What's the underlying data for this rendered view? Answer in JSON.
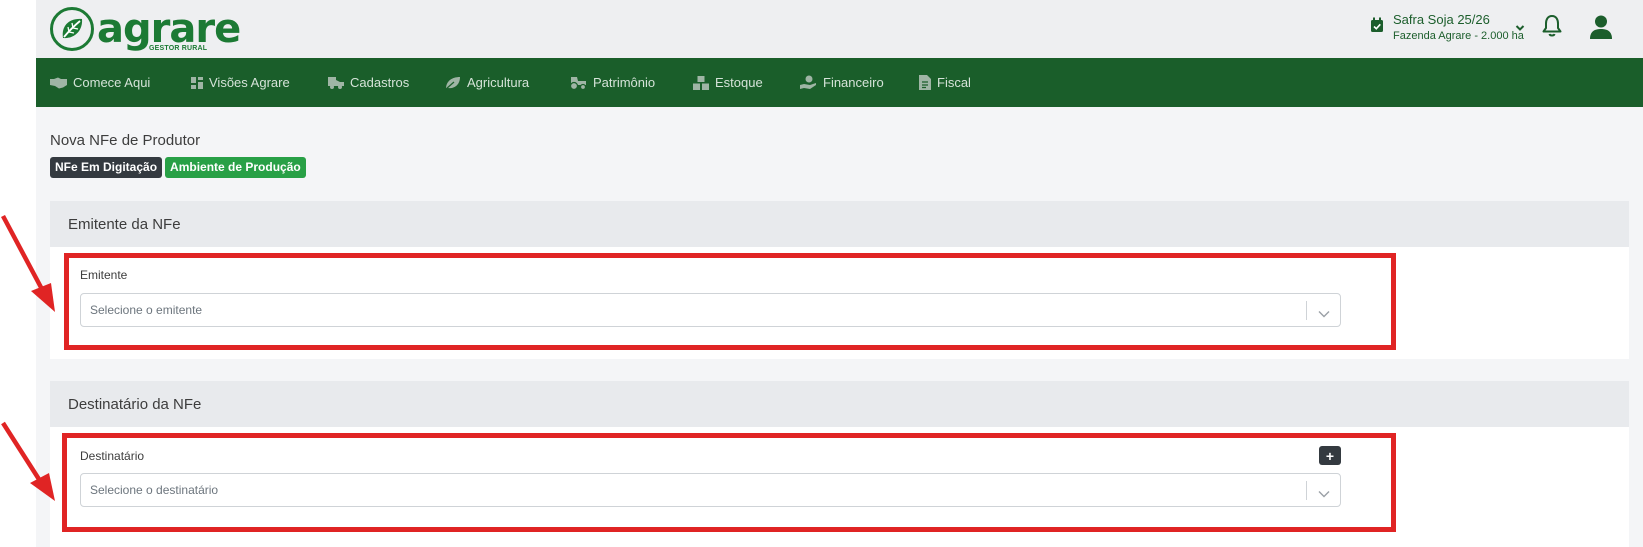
{
  "header": {
    "logo_text": "agrare",
    "logo_subtitle": "GESTOR RURAL",
    "safra_title": "Safra Soja 25/26",
    "safra_farm": "Fazenda Agrare - 2.000 ha",
    "icons": [
      "calendar-check-icon",
      "chevron-down-icon",
      "bell-icon",
      "user-icon"
    ]
  },
  "nav": {
    "items": [
      {
        "label": "Comece Aqui",
        "icon": "handshake-icon"
      },
      {
        "label": "Visões Agrare",
        "icon": "dashboard-icon"
      },
      {
        "label": "Cadastros",
        "icon": "tractor-trailer-icon"
      },
      {
        "label": "Agricultura",
        "icon": "leaf-icon"
      },
      {
        "label": "Patrimônio",
        "icon": "tractor-icon"
      },
      {
        "label": "Estoque",
        "icon": "boxes-icon"
      },
      {
        "label": "Financeiro",
        "icon": "hand-holding-dollar-icon"
      },
      {
        "label": "Fiscal",
        "icon": "file-invoice-icon"
      }
    ]
  },
  "page": {
    "title": "Nova NFe de Produtor",
    "badges": [
      {
        "label": "NFe Em Digitação",
        "color": "#343a40"
      },
      {
        "label": "Ambiente de Produção",
        "color": "#28a046"
      }
    ]
  },
  "emitente": {
    "section_title": "Emitente da NFe",
    "label": "Emitente",
    "placeholder": "Selecione o emitente"
  },
  "destinatario": {
    "section_title": "Destinatário da NFe",
    "label": "Destinatário",
    "placeholder": "Selecione o destinatário",
    "add_label": "+"
  },
  "colors": {
    "brand_green": "#1c7a34",
    "nav_green": "#1a5e2a",
    "highlight_red": "#e02424"
  }
}
